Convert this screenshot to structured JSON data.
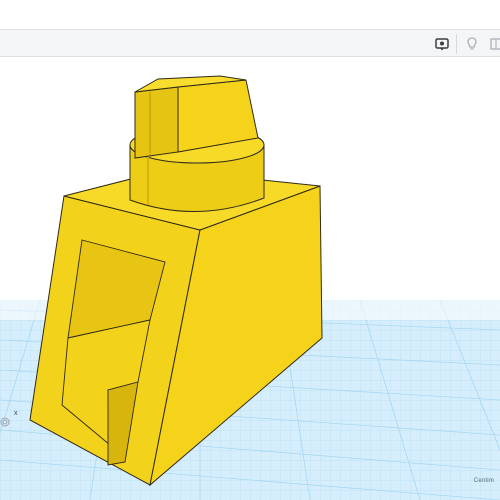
{
  "toolbar": {
    "icons": [
      "view-toggle-icon",
      "light-bulb-icon",
      "snap-icon"
    ]
  },
  "workplane": {
    "units_label": "Centim",
    "axis_label": "x"
  },
  "colors": {
    "shape_fill": "#f2d21b",
    "shape_dark": "#d9b80d",
    "shape_edge": "#2f2a1a",
    "grid_bg": "#d6eefb",
    "grid_line": "#a9d7f2",
    "toolbar_bg": "#f4f5f7"
  }
}
